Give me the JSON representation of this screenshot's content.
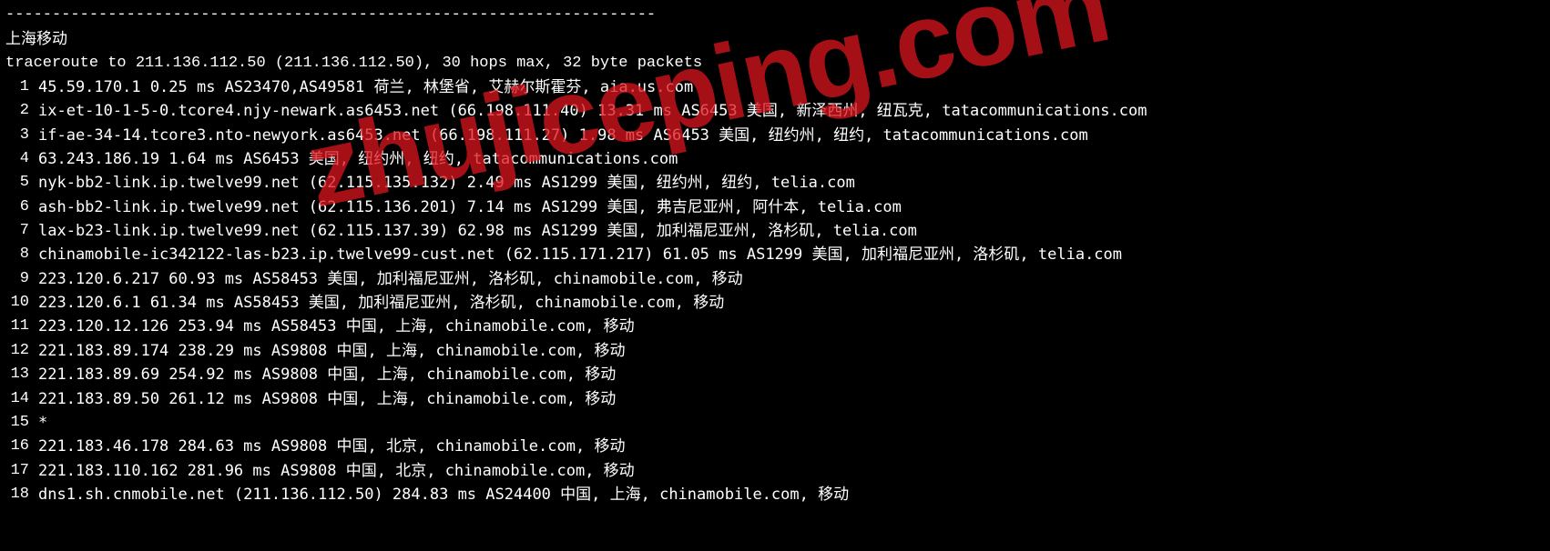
{
  "separator": "----------------------------------------------------------------------",
  "title": "上海移动",
  "traceroute_header": "traceroute to 211.136.112.50 (211.136.112.50), 30 hops max, 32 byte packets",
  "watermark": "zhujiceping.com",
  "hops": [
    {
      "num": "1",
      "detail": "45.59.170.1  0.25 ms  AS23470,AS49581  荷兰, 林堡省, 艾赫尔斯霍芬, aia.us.com"
    },
    {
      "num": "2",
      "detail": "ix-et-10-1-5-0.tcore4.njy-newark.as6453.net (66.198.111.40)  13.31 ms  AS6453  美国, 新泽西州, 纽瓦克, tatacommunications.com"
    },
    {
      "num": "3",
      "detail": "if-ae-34-14.tcore3.nto-newyork.as6453.net (66.198.111.27)  1.98 ms  AS6453  美国, 纽约州, 纽约, tatacommunications.com"
    },
    {
      "num": "4",
      "detail": "63.243.186.19  1.64 ms  AS6453  美国, 纽约州, 纽约, tatacommunications.com"
    },
    {
      "num": "5",
      "detail": "nyk-bb2-link.ip.twelve99.net (62.115.135.132)  2.49 ms  AS1299  美国, 纽约州, 纽约, telia.com"
    },
    {
      "num": "6",
      "detail": "ash-bb2-link.ip.twelve99.net (62.115.136.201)  7.14 ms  AS1299  美国, 弗吉尼亚州, 阿什本, telia.com"
    },
    {
      "num": "7",
      "detail": "lax-b23-link.ip.twelve99.net (62.115.137.39)  62.98 ms  AS1299  美国, 加利福尼亚州, 洛杉矶, telia.com"
    },
    {
      "num": "8",
      "detail": "chinamobile-ic342122-las-b23.ip.twelve99-cust.net (62.115.171.217)  61.05 ms  AS1299  美国, 加利福尼亚州, 洛杉矶, telia.com"
    },
    {
      "num": "9",
      "detail": "223.120.6.217  60.93 ms  AS58453  美国, 加利福尼亚州, 洛杉矶, chinamobile.com, 移动"
    },
    {
      "num": "10",
      "detail": "223.120.6.1  61.34 ms  AS58453  美国, 加利福尼亚州, 洛杉矶, chinamobile.com, 移动"
    },
    {
      "num": "11",
      "detail": "223.120.12.126  253.94 ms  AS58453  中国, 上海, chinamobile.com, 移动"
    },
    {
      "num": "12",
      "detail": "221.183.89.174  238.29 ms  AS9808  中国, 上海, chinamobile.com, 移动"
    },
    {
      "num": "13",
      "detail": "221.183.89.69  254.92 ms  AS9808  中国, 上海, chinamobile.com, 移动"
    },
    {
      "num": "14",
      "detail": "221.183.89.50  261.12 ms  AS9808  中国, 上海, chinamobile.com, 移动"
    },
    {
      "num": "15",
      "detail": "*"
    },
    {
      "num": "16",
      "detail": "221.183.46.178  284.63 ms  AS9808  中国, 北京, chinamobile.com, 移动"
    },
    {
      "num": "17",
      "detail": "221.183.110.162  281.96 ms  AS9808  中国, 北京, chinamobile.com, 移动"
    },
    {
      "num": "18",
      "detail": "dns1.sh.cnmobile.net (211.136.112.50)  284.83 ms  AS24400  中国, 上海, chinamobile.com, 移动"
    }
  ]
}
